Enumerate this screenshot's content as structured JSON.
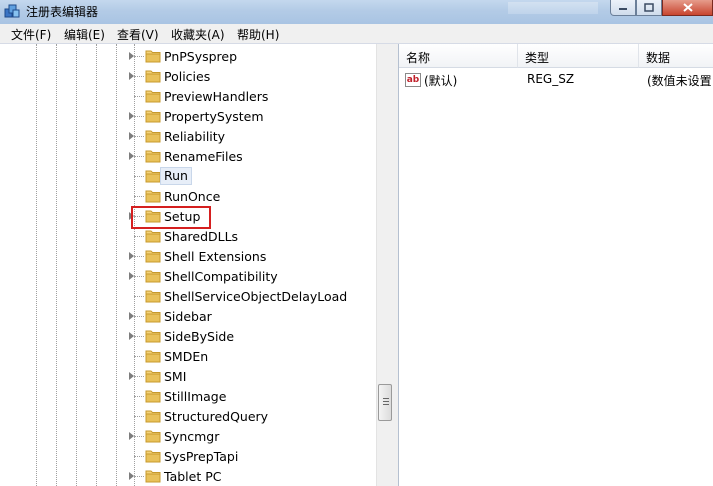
{
  "window": {
    "title": "注册表编辑器"
  },
  "menu": [
    "文件(F)",
    "编辑(E)",
    "查看(V)",
    "收藏夹(A)",
    "帮助(H)"
  ],
  "tree": {
    "items": [
      {
        "label": "PnPSysprep",
        "expandable": true
      },
      {
        "label": "Policies",
        "expandable": true
      },
      {
        "label": "PreviewHandlers",
        "expandable": false
      },
      {
        "label": "PropertySystem",
        "expandable": true
      },
      {
        "label": "Reliability",
        "expandable": true
      },
      {
        "label": "RenameFiles",
        "expandable": true
      },
      {
        "label": "Run",
        "expandable": false,
        "selected": true
      },
      {
        "label": "RunOnce",
        "expandable": false
      },
      {
        "label": "Setup",
        "expandable": true
      },
      {
        "label": "SharedDLLs",
        "expandable": false
      },
      {
        "label": "Shell Extensions",
        "expandable": true
      },
      {
        "label": "ShellCompatibility",
        "expandable": true
      },
      {
        "label": "ShellServiceObjectDelayLoad",
        "expandable": false
      },
      {
        "label": "Sidebar",
        "expandable": true
      },
      {
        "label": "SideBySide",
        "expandable": true
      },
      {
        "label": "SMDEn",
        "expandable": false
      },
      {
        "label": "SMI",
        "expandable": true
      },
      {
        "label": "StillImage",
        "expandable": false
      },
      {
        "label": "StructuredQuery",
        "expandable": false
      },
      {
        "label": "Syncmgr",
        "expandable": true
      },
      {
        "label": "SysPrepTapi",
        "expandable": false
      },
      {
        "label": "Tablet PC",
        "expandable": true
      }
    ]
  },
  "list": {
    "columns": [
      "名称",
      "类型",
      "数据"
    ],
    "rows": [
      {
        "name": "(默认)",
        "type": "REG_SZ",
        "data": "(数值未设置"
      }
    ]
  },
  "colors": {
    "highlight": "#d51f1f",
    "folder": "#e8c15a"
  }
}
